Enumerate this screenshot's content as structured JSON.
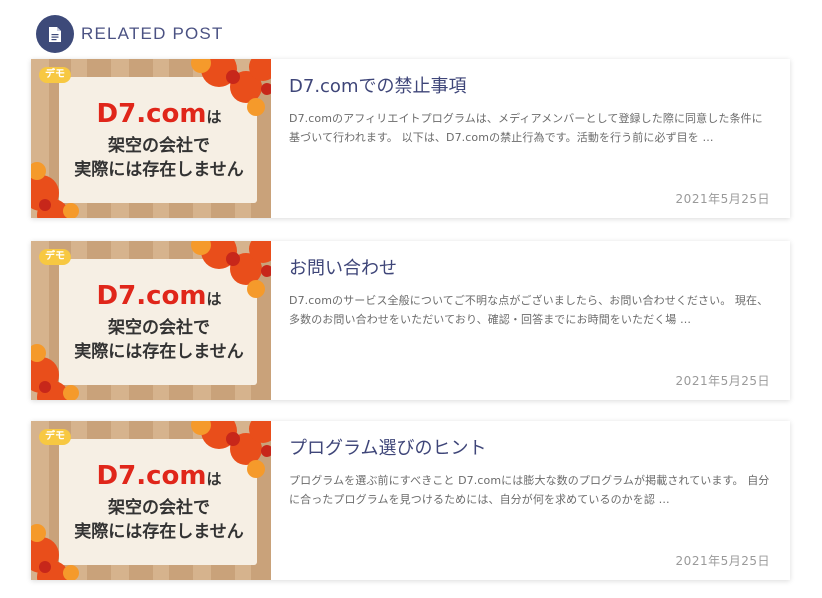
{
  "section": {
    "title": "RELATED POST",
    "icon": "document-icon",
    "accent": "#3d4a79"
  },
  "posts": [
    {
      "tag": "デモ",
      "thumb": {
        "l1_main": "D7.com",
        "l1_suffix": "は",
        "l2": "架空の会社で",
        "l3": "実際には存在しません"
      },
      "title": "D7.comでの禁止事項",
      "excerpt": "D7.comのアフィリエイトプログラムは、メディアメンバーとして登録した際に同意した条件に基づいて行われます。 以下は、D7.comの禁止行為です。活動を行う前に必ず目を …",
      "date": "2021年5月25日"
    },
    {
      "tag": "デモ",
      "thumb": {
        "l1_main": "D7.com",
        "l1_suffix": "は",
        "l2": "架空の会社で",
        "l3": "実際には存在しません"
      },
      "title": "お問い合わせ",
      "excerpt": "D7.comのサービス全般についてご不明な点がございましたら、お問い合わせください。 現在、多数のお問い合わせをいただいており、確認・回答までにお時間をいただく場 …",
      "date": "2021年5月25日"
    },
    {
      "tag": "デモ",
      "thumb": {
        "l1_main": "D7.com",
        "l1_suffix": "は",
        "l2": "架空の会社で",
        "l3": "実際には存在しません"
      },
      "title": "プログラム選びのヒント",
      "excerpt": "プログラムを選ぶ前にすべきこと D7.comには膨大な数のプログラムが掲載されています。 自分に合ったプログラムを見つけるためには、自分が何を求めているのかを認 …",
      "date": "2021年5月25日"
    }
  ]
}
